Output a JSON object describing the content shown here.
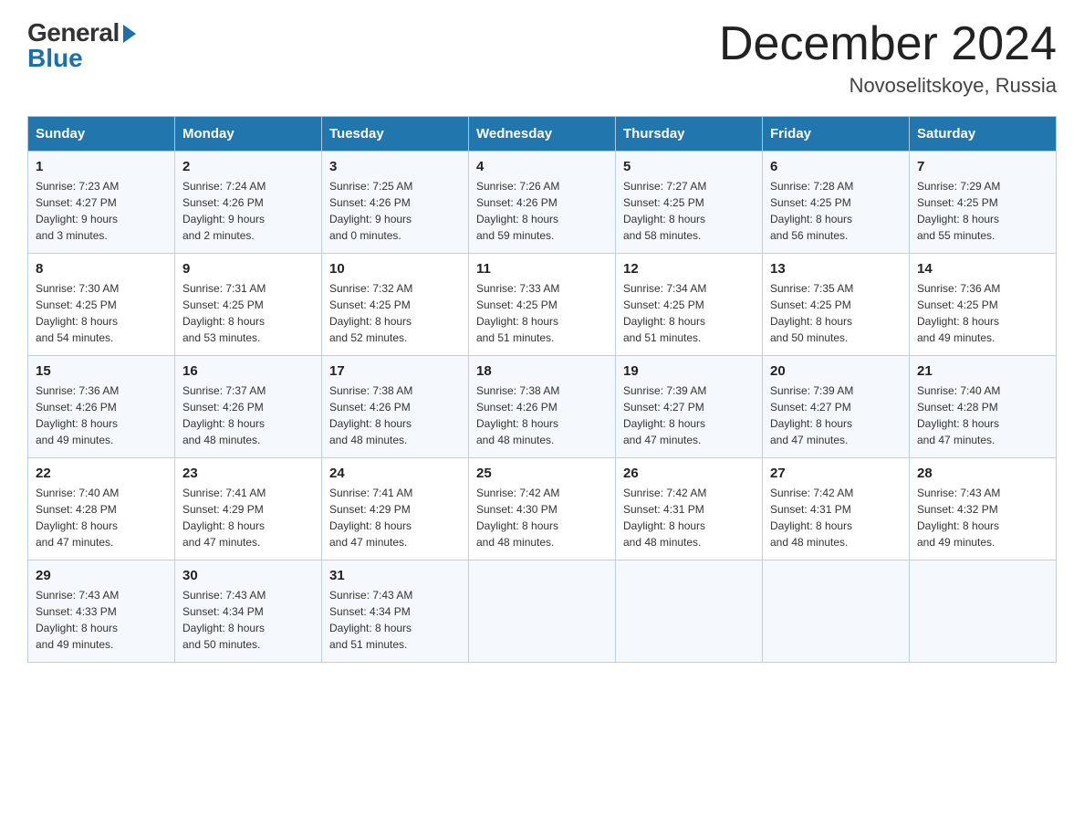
{
  "logo": {
    "general": "General",
    "blue": "Blue"
  },
  "title": "December 2024",
  "location": "Novoselitskoye, Russia",
  "headers": [
    "Sunday",
    "Monday",
    "Tuesday",
    "Wednesday",
    "Thursday",
    "Friday",
    "Saturday"
  ],
  "weeks": [
    [
      {
        "day": "1",
        "sunrise": "7:23 AM",
        "sunset": "4:27 PM",
        "daylight": "9 hours and 3 minutes."
      },
      {
        "day": "2",
        "sunrise": "7:24 AM",
        "sunset": "4:26 PM",
        "daylight": "9 hours and 2 minutes."
      },
      {
        "day": "3",
        "sunrise": "7:25 AM",
        "sunset": "4:26 PM",
        "daylight": "9 hours and 0 minutes."
      },
      {
        "day": "4",
        "sunrise": "7:26 AM",
        "sunset": "4:26 PM",
        "daylight": "8 hours and 59 minutes."
      },
      {
        "day": "5",
        "sunrise": "7:27 AM",
        "sunset": "4:25 PM",
        "daylight": "8 hours and 58 minutes."
      },
      {
        "day": "6",
        "sunrise": "7:28 AM",
        "sunset": "4:25 PM",
        "daylight": "8 hours and 56 minutes."
      },
      {
        "day": "7",
        "sunrise": "7:29 AM",
        "sunset": "4:25 PM",
        "daylight": "8 hours and 55 minutes."
      }
    ],
    [
      {
        "day": "8",
        "sunrise": "7:30 AM",
        "sunset": "4:25 PM",
        "daylight": "8 hours and 54 minutes."
      },
      {
        "day": "9",
        "sunrise": "7:31 AM",
        "sunset": "4:25 PM",
        "daylight": "8 hours and 53 minutes."
      },
      {
        "day": "10",
        "sunrise": "7:32 AM",
        "sunset": "4:25 PM",
        "daylight": "8 hours and 52 minutes."
      },
      {
        "day": "11",
        "sunrise": "7:33 AM",
        "sunset": "4:25 PM",
        "daylight": "8 hours and 51 minutes."
      },
      {
        "day": "12",
        "sunrise": "7:34 AM",
        "sunset": "4:25 PM",
        "daylight": "8 hours and 51 minutes."
      },
      {
        "day": "13",
        "sunrise": "7:35 AM",
        "sunset": "4:25 PM",
        "daylight": "8 hours and 50 minutes."
      },
      {
        "day": "14",
        "sunrise": "7:36 AM",
        "sunset": "4:25 PM",
        "daylight": "8 hours and 49 minutes."
      }
    ],
    [
      {
        "day": "15",
        "sunrise": "7:36 AM",
        "sunset": "4:26 PM",
        "daylight": "8 hours and 49 minutes."
      },
      {
        "day": "16",
        "sunrise": "7:37 AM",
        "sunset": "4:26 PM",
        "daylight": "8 hours and 48 minutes."
      },
      {
        "day": "17",
        "sunrise": "7:38 AM",
        "sunset": "4:26 PM",
        "daylight": "8 hours and 48 minutes."
      },
      {
        "day": "18",
        "sunrise": "7:38 AM",
        "sunset": "4:26 PM",
        "daylight": "8 hours and 48 minutes."
      },
      {
        "day": "19",
        "sunrise": "7:39 AM",
        "sunset": "4:27 PM",
        "daylight": "8 hours and 47 minutes."
      },
      {
        "day": "20",
        "sunrise": "7:39 AM",
        "sunset": "4:27 PM",
        "daylight": "8 hours and 47 minutes."
      },
      {
        "day": "21",
        "sunrise": "7:40 AM",
        "sunset": "4:28 PM",
        "daylight": "8 hours and 47 minutes."
      }
    ],
    [
      {
        "day": "22",
        "sunrise": "7:40 AM",
        "sunset": "4:28 PM",
        "daylight": "8 hours and 47 minutes."
      },
      {
        "day": "23",
        "sunrise": "7:41 AM",
        "sunset": "4:29 PM",
        "daylight": "8 hours and 47 minutes."
      },
      {
        "day": "24",
        "sunrise": "7:41 AM",
        "sunset": "4:29 PM",
        "daylight": "8 hours and 47 minutes."
      },
      {
        "day": "25",
        "sunrise": "7:42 AM",
        "sunset": "4:30 PM",
        "daylight": "8 hours and 48 minutes."
      },
      {
        "day": "26",
        "sunrise": "7:42 AM",
        "sunset": "4:31 PM",
        "daylight": "8 hours and 48 minutes."
      },
      {
        "day": "27",
        "sunrise": "7:42 AM",
        "sunset": "4:31 PM",
        "daylight": "8 hours and 48 minutes."
      },
      {
        "day": "28",
        "sunrise": "7:43 AM",
        "sunset": "4:32 PM",
        "daylight": "8 hours and 49 minutes."
      }
    ],
    [
      {
        "day": "29",
        "sunrise": "7:43 AM",
        "sunset": "4:33 PM",
        "daylight": "8 hours and 49 minutes."
      },
      {
        "day": "30",
        "sunrise": "7:43 AM",
        "sunset": "4:34 PM",
        "daylight": "8 hours and 50 minutes."
      },
      {
        "day": "31",
        "sunrise": "7:43 AM",
        "sunset": "4:34 PM",
        "daylight": "8 hours and 51 minutes."
      },
      null,
      null,
      null,
      null
    ]
  ],
  "labels": {
    "sunrise_prefix": "Sunrise: ",
    "sunset_prefix": "Sunset: ",
    "daylight_prefix": "Daylight: "
  }
}
